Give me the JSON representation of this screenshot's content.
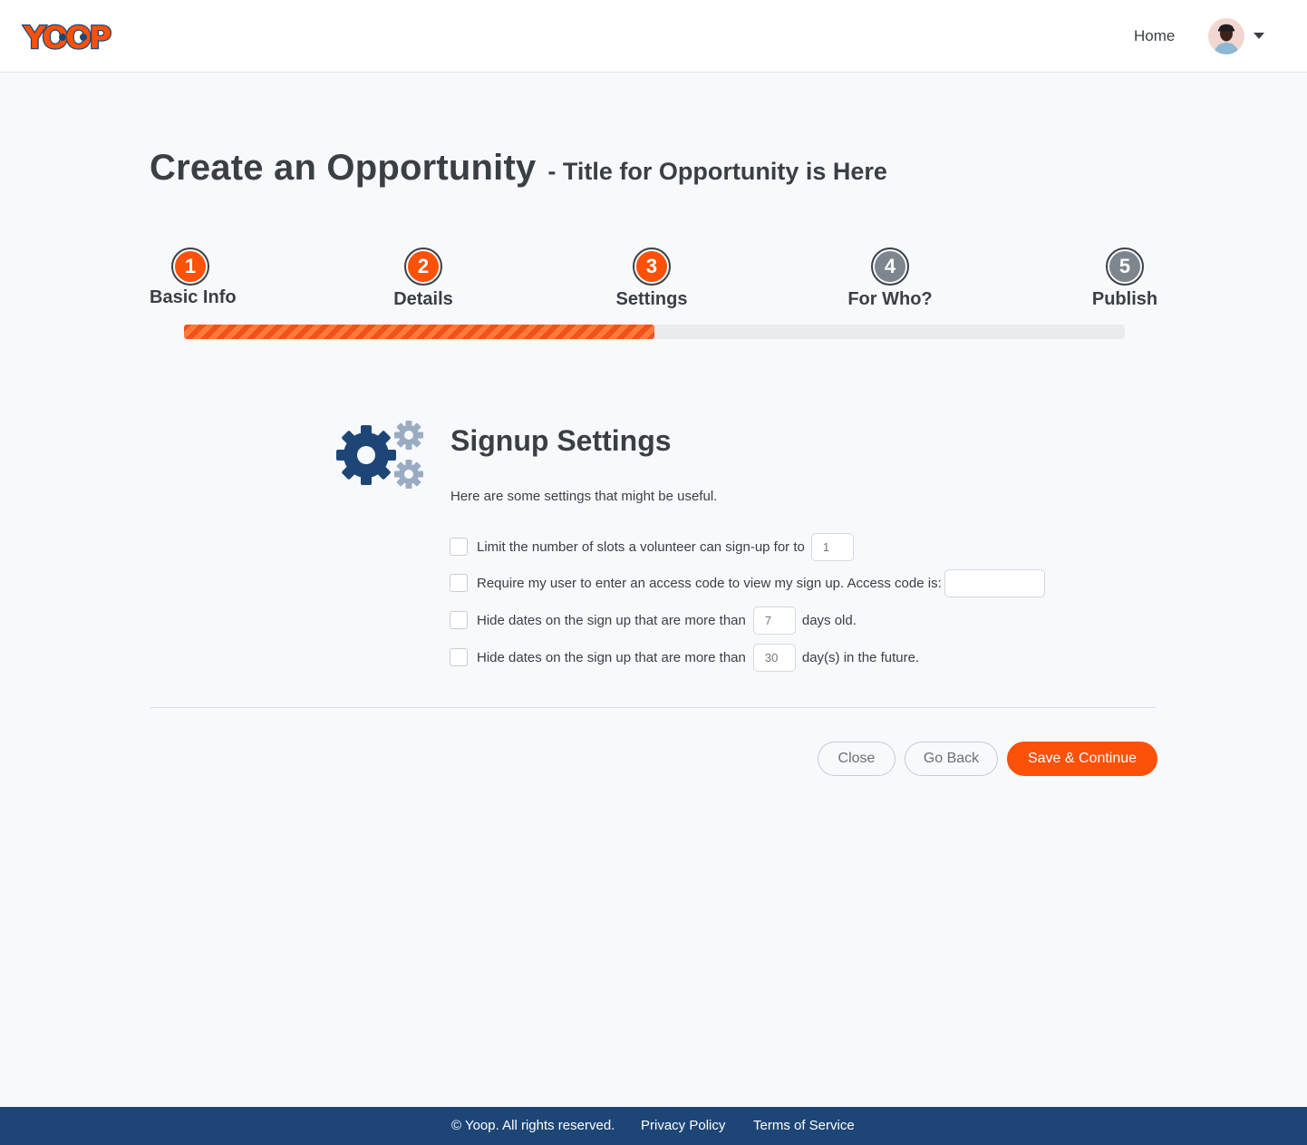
{
  "header": {
    "logo_text": "YOOP",
    "nav_home": "Home"
  },
  "page": {
    "title": "Create an Opportunity",
    "subtitle": "- Title for Opportunity is Here"
  },
  "stepper": {
    "steps": [
      {
        "number": "1",
        "label": "Basic Info",
        "state": "complete"
      },
      {
        "number": "2",
        "label": "Details",
        "state": "complete"
      },
      {
        "number": "3",
        "label": "Settings",
        "state": "current"
      },
      {
        "number": "4",
        "label": "For Who?",
        "state": "pending"
      },
      {
        "number": "5",
        "label": "Publish",
        "state": "pending"
      }
    ],
    "progress_percent": 50
  },
  "settings": {
    "title": "Signup Settings",
    "description": "Here are some settings that might be useful.",
    "options": [
      {
        "text_before": "Limit the number of slots a volunteer can sign-up for to",
        "value": "",
        "placeholder": "1",
        "text_after": "",
        "checked": false
      },
      {
        "text_before": "Require my user to enter an access code to view my sign up. Access code is:",
        "value": "",
        "placeholder": "",
        "text_after": "",
        "checked": false
      },
      {
        "text_before": "Hide dates on the sign up that are more than",
        "value": "",
        "placeholder": "7",
        "text_after": "days old.",
        "checked": false
      },
      {
        "text_before": "Hide dates on the sign up that are more than",
        "value": "",
        "placeholder": "30",
        "text_after": "day(s) in the future.",
        "checked": false
      }
    ]
  },
  "actions": {
    "close": "Close",
    "go_back": "Go Back",
    "save_continue": "Save & Continue"
  },
  "footer": {
    "copyright": "© Yoop. All rights reserved.",
    "privacy": "Privacy Policy",
    "terms": "Terms of Service"
  },
  "colors": {
    "accent": "#fb5108",
    "pending_step": "#7d858d",
    "footer_bg": "#1d4677",
    "gear_primary": "#1d4677",
    "gear_secondary": "#9aacc2"
  }
}
